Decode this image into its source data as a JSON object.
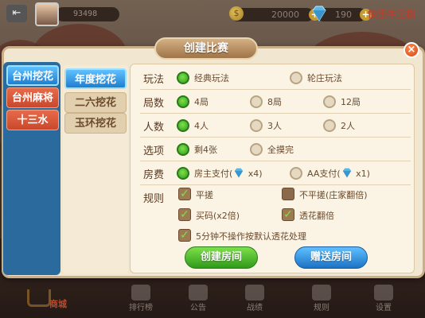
{
  "topbar": {
    "player_id": "93498",
    "coins": "20000",
    "gems": "190",
    "brand": "快乐牛王棋"
  },
  "modal": {
    "title": "创建比赛",
    "close": "×"
  },
  "left_tabs": [
    {
      "label": "台州挖花",
      "selected": true
    },
    {
      "label": "台州麻将",
      "selected": false
    },
    {
      "label": "十三水",
      "selected": false
    }
  ],
  "sub_tabs": [
    {
      "label": "年度挖花",
      "selected": true
    },
    {
      "label": "二六挖花",
      "selected": false
    },
    {
      "label": "玉环挖花",
      "selected": false
    }
  ],
  "settings": {
    "play_mode": {
      "label": "玩法",
      "options": [
        {
          "text": "经典玩法",
          "on": true
        },
        {
          "text": "轮庄玩法",
          "on": false
        }
      ]
    },
    "rounds": {
      "label": "局数",
      "options": [
        {
          "text": "4局",
          "on": true
        },
        {
          "text": "8局",
          "on": false
        },
        {
          "text": "12局",
          "on": false
        }
      ]
    },
    "players": {
      "label": "人数",
      "options": [
        {
          "text": "4人",
          "on": true
        },
        {
          "text": "3人",
          "on": false
        },
        {
          "text": "2人",
          "on": false
        }
      ]
    },
    "option": {
      "label": "选项",
      "options": [
        {
          "text": "剩4张",
          "on": true
        },
        {
          "text": "全摸完",
          "on": false
        }
      ]
    },
    "fee": {
      "label": "房费",
      "options": [
        {
          "text": "房主支付(",
          "suffix": " x4)",
          "on": true
        },
        {
          "text": "AA支付(",
          "suffix": " x1)",
          "on": false
        }
      ]
    },
    "rules": {
      "label": "规则",
      "items": [
        {
          "text": "平搓",
          "checked": true
        },
        {
          "text": "不平搓(庄家翻倍)",
          "checked": false
        },
        {
          "text": "买码(x2倍)",
          "checked": true
        },
        {
          "text": "透花翻倍",
          "checked": true
        },
        {
          "text": "5分钟不操作按默认透花处理",
          "checked": true
        }
      ]
    }
  },
  "buttons": {
    "create": "创建房间",
    "gift": "赠送房间"
  },
  "bottom": {
    "shop": "商城",
    "ranking": "排行榜",
    "notice": "公告",
    "battle": "战绩",
    "rules": "规则",
    "settings": "设置"
  }
}
